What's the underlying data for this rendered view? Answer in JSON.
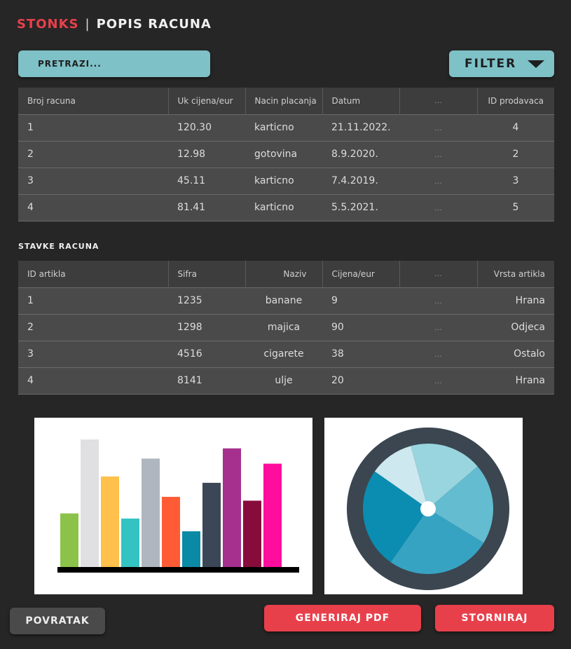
{
  "header": {
    "brand": "STONKS",
    "separator": "|",
    "page_title": "POPIS RACUNA"
  },
  "search": {
    "placeholder": "PRETRAZI..."
  },
  "filter": {
    "label": "FILTER",
    "icon": "caret-down-icon"
  },
  "invoices": {
    "columns": [
      "Broj racuna",
      "Uk cijena/eur",
      "Nacin placanja",
      "Datum",
      "...",
      "ID prodavaca"
    ],
    "rows": [
      [
        "1",
        "120.30",
        "karticno",
        "21.11.2022.",
        "...",
        "4"
      ],
      [
        "2",
        "12.98",
        "gotovina",
        "8.9.2020.",
        "...",
        "2"
      ],
      [
        "3",
        "45.11",
        "karticno",
        "7.4.2019.",
        "...",
        "3"
      ],
      [
        "4",
        "81.41",
        "karticno",
        "5.5.2021.",
        "...",
        "5"
      ]
    ]
  },
  "items_section": {
    "title": "STAVKE RACUNA"
  },
  "items": {
    "columns": [
      "ID artikla",
      "Sifra",
      "Naziv",
      "Cijena/eur",
      "...",
      "Vrsta artikla"
    ],
    "rows": [
      [
        "1",
        "1235",
        "banane",
        "9",
        "...",
        "Hrana"
      ],
      [
        "2",
        "1298",
        "majica",
        "90",
        "...",
        "Odjeca"
      ],
      [
        "3",
        "4516",
        "cigarete",
        "38",
        "...",
        "Ostalo"
      ],
      [
        "4",
        "8141",
        "ulje",
        "20",
        "...",
        "Hrana"
      ]
    ]
  },
  "buttons": {
    "back": "POVRATAK",
    "pdf": "GENERIRAJ PDF",
    "cancel": "STORNIRAJ"
  },
  "colors": {
    "brand": "#e8404b",
    "accent": "#7ec1c7",
    "background": "#262626"
  },
  "chart_data": [
    {
      "type": "bar",
      "values": [
        42,
        100,
        71,
        38,
        85,
        55,
        28,
        66,
        93,
        52,
        81
      ],
      "colors": [
        "#8bc34a",
        "#e0e0e3",
        "#ffc04c",
        "#34c3c3",
        "#b0b6bf",
        "#ff5c36",
        "#0b8aa6",
        "#3b4757",
        "#a5308e",
        "#870c3c",
        "#ff0d9c"
      ],
      "ylim": [
        0,
        100
      ],
      "grid": false,
      "legend": "none"
    },
    {
      "type": "pie",
      "values": [
        11,
        18,
        20,
        26,
        25
      ],
      "colors": [
        "#cde8ee",
        "#99d5df",
        "#63bcd0",
        "#36a3c2",
        "#0a8db0"
      ],
      "ring_color": "#3b4650",
      "start_angle_deg": -55,
      "legend": "none"
    }
  ]
}
